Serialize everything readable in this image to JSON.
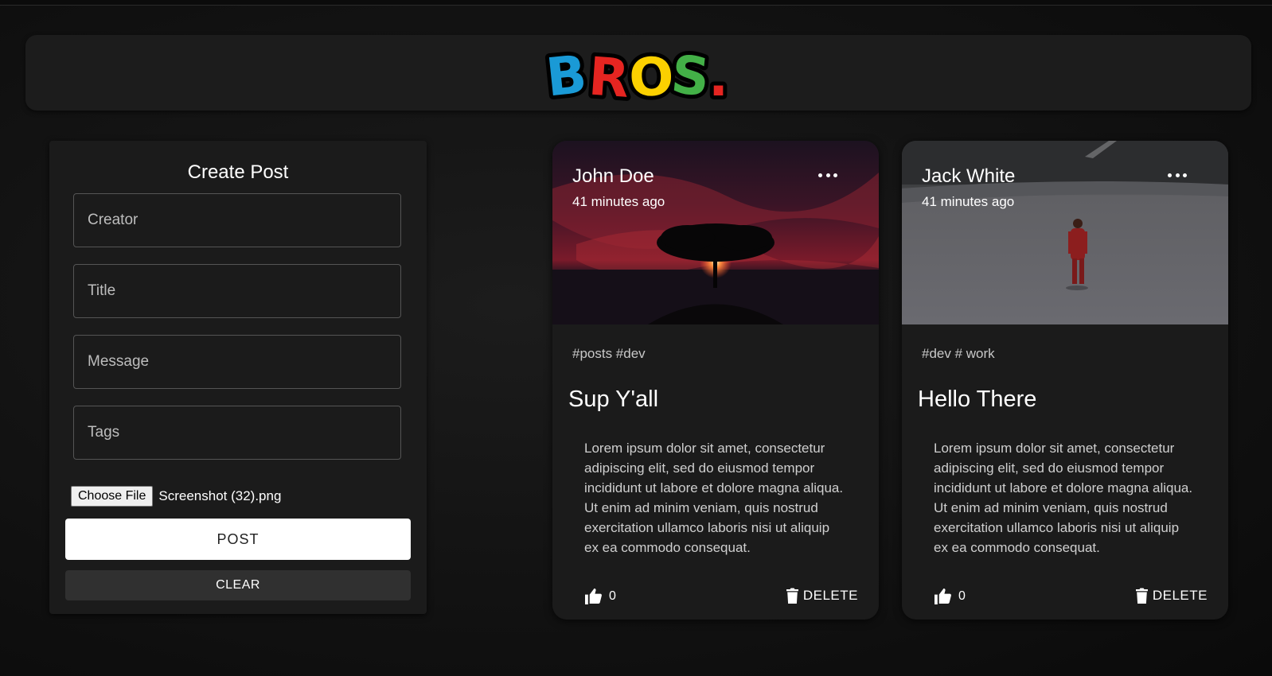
{
  "header": {
    "logo_text": "BROS.",
    "logo_letters": [
      "B",
      "R",
      "O",
      "S",
      "."
    ]
  },
  "form": {
    "title": "Create Post",
    "creator_placeholder": "Creator",
    "title_placeholder": "Title",
    "message_placeholder": "Message",
    "tags_placeholder": "Tags",
    "file_button": "Choose File",
    "file_name": "Screenshot (32).png",
    "post_label": "POST",
    "clear_label": "CLEAR"
  },
  "posts": [
    {
      "creator": "John Doe",
      "time": "41 minutes ago",
      "tags": "#posts #dev",
      "title": "Sup Y'all",
      "message": "Lorem ipsum dolor sit amet, consectetur adipiscing elit, sed do eiusmod tempor incididunt ut labore et dolore magna aliqua. Ut enim ad minim veniam, quis nostrud exercitation ullamco laboris nisi ut aliquip ex ea commodo consequat.",
      "likes": "0",
      "delete_label": "DELETE",
      "image": "sunset-tree-image"
    },
    {
      "creator": "Jack White",
      "time": "41 minutes ago",
      "tags": "#dev # work",
      "title": "Hello There",
      "message": "Lorem ipsum dolor sit amet, consectetur adipiscing elit, sed do eiusmod tempor incididunt ut labore et dolore magna aliqua. Ut enim ad minim veniam, quis nostrud exercitation ullamco laboris nisi ut aliquip ex ea commodo consequat.",
      "likes": "0",
      "delete_label": "DELETE",
      "image": "snow-stadium-person-image"
    }
  ],
  "colors": {
    "logo_b": "#1a9ad6",
    "logo_r": "#e52521",
    "logo_o": "#fbd000",
    "logo_s": "#43b047",
    "background": "#111111",
    "card": "#1b1b1b"
  }
}
